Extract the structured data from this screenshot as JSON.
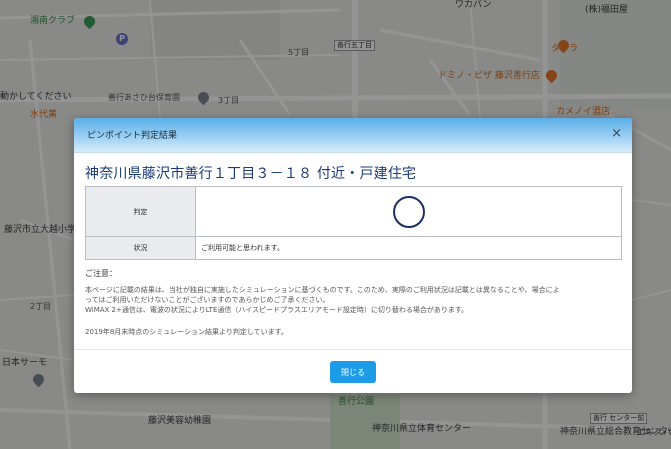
{
  "map": {
    "labels": {
      "shonan_club": "湘南クラブ",
      "move_notice": "動かしてください",
      "mizushiro": "水代黄",
      "zengyo_asahi": "善行あさひ台保育園",
      "chome3": "3丁目",
      "chome5": "5丁目",
      "zengyo5": "善行五丁目",
      "tawara": "タワラ",
      "domino": "ドミノ・ピザ 藤沢善行店",
      "kamenoi": "カメノイ酒店",
      "fujisawa_otsuki": "藤沢市立大越小学校",
      "chome2": "2丁目",
      "nihon_sarmo": "日本サーモ",
      "zengyo_park": "善行公園",
      "fujisawa_bijutsu": "藤沢美容幼稚園",
      "pref_gym": "神奈川県立体育センター",
      "pref_education": "神奈川県立総合教育センター",
      "ekisupa": "エキスパ",
      "top_bank": "(株)福田屋",
      "top_shop": "ワカバン",
      "bottom_station": "善行\nセンター前",
      "kamenoi_top": "カメノイ"
    }
  },
  "modal": {
    "title": "ピンポイント判定結果",
    "close_x": "×",
    "address": "神奈川県藤沢市善行１丁目３－１８ 付近・戸建住宅",
    "table": {
      "judge_label": "判定",
      "status_label": "状況",
      "status_value": "ご利用可能と思われます。"
    },
    "notes_heading": "ご注意：",
    "notes": [
      "本ページに記載の結果は、当社が独自に実施したシミュレーションに基づくものです。このため、実際のご利用状況は記載とは異なることや、場合によ",
      "ってはご利用いただけないことがございますのであらかじめご了承ください。",
      "WiMAX 2+通信は、電波の状況によりLTE通信（ハイスピードプラスエリアモード設定時）に切り替わる場合があります。"
    ],
    "date_note": "2019年8月末時点のシミュレーション結果より判定しています。",
    "close_button": "閉じる"
  },
  "colors": {
    "accent": "#1e9be6",
    "address_text": "#1a3a78",
    "circle_mark": "#1a2f66"
  }
}
